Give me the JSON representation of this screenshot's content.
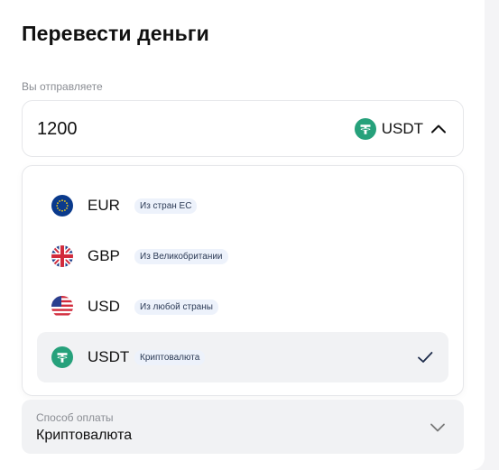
{
  "title": "Перевести деньги",
  "send": {
    "label": "Вы отправляете",
    "amount": "1200",
    "currency": "USDT"
  },
  "options": [
    {
      "code": "EUR",
      "badge": "Из стран ЕС",
      "icon": "eu-flag-icon",
      "selected": false
    },
    {
      "code": "GBP",
      "badge": "Из Великобритании",
      "icon": "uk-flag-icon",
      "selected": false
    },
    {
      "code": "USD",
      "badge": "Из любой страны",
      "icon": "us-flag-icon",
      "selected": false
    },
    {
      "code": "USDT",
      "badge": "Криптовалюта",
      "icon": "tether-icon",
      "selected": true
    }
  ],
  "payment": {
    "label": "Способ оплаты",
    "value": "Криптовалюта"
  },
  "colors": {
    "tether": "#26a17b",
    "eu_blue": "#0a3a8c",
    "check": "#1c2b4a"
  }
}
